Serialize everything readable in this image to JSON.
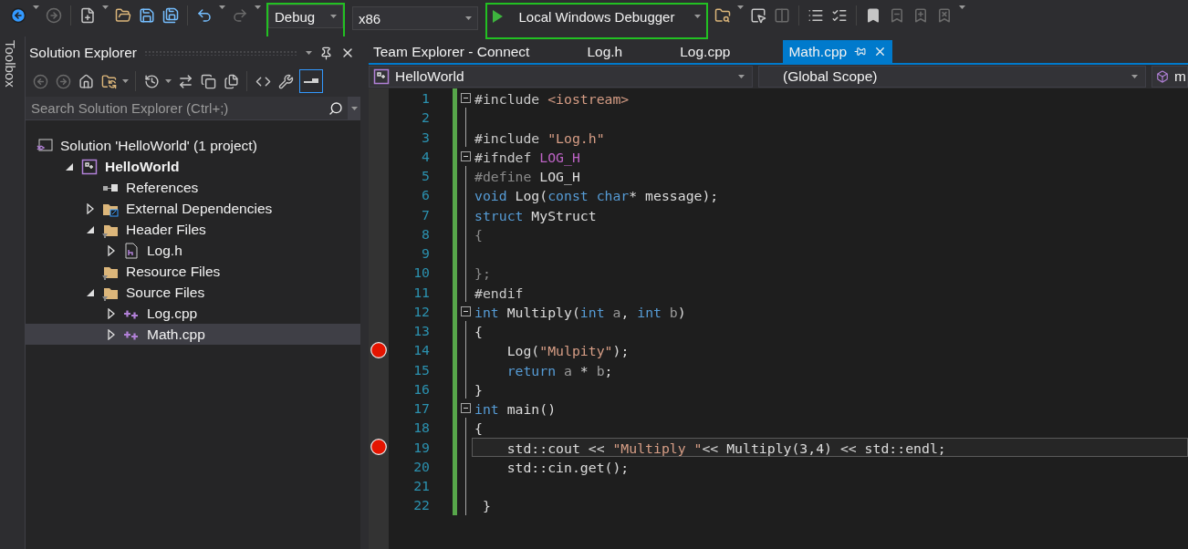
{
  "toolbar": {
    "dropdowns": [
      {
        "kind": "combo",
        "label": "Debug",
        "highlighted": true
      },
      {
        "kind": "combo",
        "label": "x86",
        "highlighted": false
      },
      {
        "kind": "run",
        "label": "Local Windows Debugger",
        "highlighted": true
      }
    ]
  },
  "toolbox": {
    "label": "Toolbox"
  },
  "solution_explorer": {
    "title": "Solution Explorer",
    "preview_on": true,
    "search": {
      "placeholder": "Search Solution Explorer (Ctrl+;)"
    },
    "tree": [
      {
        "kind": "solution",
        "label": "Solution 'HelloWorld' (1 project)",
        "selected": false
      },
      {
        "kind": "project",
        "label": "HelloWorld",
        "selected": false,
        "expanded": true,
        "children": [
          {
            "kind": "references",
            "label": "References",
            "selected": false
          },
          {
            "kind": "external",
            "label": "External Dependencies",
            "selected": false,
            "expanded": false
          },
          {
            "kind": "filter",
            "label": "Header Files",
            "selected": false,
            "expanded": true,
            "children": [
              {
                "kind": "header",
                "label": "Log.h",
                "selected": false,
                "expanded": false
              }
            ]
          },
          {
            "kind": "filter",
            "label": "Resource Files",
            "selected": false
          },
          {
            "kind": "filter",
            "label": "Source Files",
            "selected": false,
            "expanded": true,
            "children": [
              {
                "kind": "cpp",
                "label": "Log.cpp",
                "selected": false,
                "expanded": false
              },
              {
                "kind": "cpp",
                "label": "Math.cpp",
                "selected": true,
                "expanded": false
              }
            ]
          }
        ]
      }
    ]
  },
  "editor": {
    "tabs": [
      {
        "label": "Team Explorer - Connect",
        "selected": false
      },
      {
        "label": "Log.h",
        "selected": false
      },
      {
        "label": "Log.cpp",
        "selected": false
      },
      {
        "label": "Math.cpp",
        "selected": true
      }
    ],
    "navigation": [
      {
        "kind": "project",
        "label": "HelloWorld"
      },
      {
        "kind": "scope",
        "label": "(Global Scope)"
      },
      {
        "kind": "member",
        "label": "m"
      }
    ],
    "lines": [
      {
        "number": "1",
        "kind": "fold",
        "tokens": [
          {
            "kind": "directive",
            "text": "#include "
          },
          {
            "kind": "string",
            "text": "<iostream>"
          }
        ]
      },
      {
        "number": "2",
        "kind": "code"
      },
      {
        "number": "3",
        "kind": "code",
        "tokens": [
          {
            "kind": "directive",
            "text": "#include "
          },
          {
            "kind": "string",
            "text": "\"Log.h\""
          }
        ]
      },
      {
        "number": "4",
        "kind": "fold",
        "tokens": [
          {
            "kind": "directive",
            "text": "#ifndef "
          },
          {
            "kind": "macro",
            "text": "LOG_H"
          }
        ]
      },
      {
        "number": "5",
        "kind": "code",
        "tokens": [
          {
            "kind": "dim",
            "text": "#define"
          },
          {
            "kind": "plain",
            "text": " LOG_H"
          }
        ]
      },
      {
        "number": "6",
        "kind": "code",
        "tokens": [
          {
            "kind": "keyword",
            "text": "void"
          },
          {
            "kind": "plain",
            "text": " Log("
          },
          {
            "kind": "keyword",
            "text": "const char"
          },
          {
            "kind": "plain",
            "text": "* message);"
          }
        ]
      },
      {
        "number": "7",
        "kind": "code",
        "tokens": [
          {
            "kind": "keyword",
            "text": "struct"
          },
          {
            "kind": "plain",
            "text": " MyStruct"
          }
        ]
      },
      {
        "number": "8",
        "kind": "code",
        "tokens": [
          {
            "kind": "dim",
            "text": "{"
          }
        ]
      },
      {
        "number": "9",
        "kind": "code"
      },
      {
        "number": "10",
        "kind": "code",
        "tokens": [
          {
            "kind": "dim",
            "text": "};"
          }
        ]
      },
      {
        "number": "11",
        "kind": "code",
        "tokens": [
          {
            "kind": "directive",
            "text": "#endif"
          }
        ]
      },
      {
        "number": "12",
        "kind": "fold",
        "tokens": [
          {
            "kind": "keyword",
            "text": "int"
          },
          {
            "kind": "plain",
            "text": " Multiply("
          },
          {
            "kind": "keyword",
            "text": "int "
          },
          {
            "kind": "param",
            "text": "a"
          },
          {
            "kind": "plain",
            "text": ", "
          },
          {
            "kind": "keyword",
            "text": "int "
          },
          {
            "kind": "param",
            "text": "b"
          },
          {
            "kind": "plain",
            "text": ")"
          }
        ]
      },
      {
        "number": "13",
        "kind": "code",
        "tokens": [
          {
            "kind": "plain",
            "text": "{"
          }
        ]
      },
      {
        "number": "14",
        "kind": "breakpoint",
        "tokens": [
          {
            "kind": "plain",
            "text": "    Log("
          },
          {
            "kind": "string",
            "text": "\"Mulpity\""
          },
          {
            "kind": "plain",
            "text": ");"
          }
        ]
      },
      {
        "number": "15",
        "kind": "code",
        "tokens": [
          {
            "kind": "keyword",
            "text": "    return "
          },
          {
            "kind": "param",
            "text": "a"
          },
          {
            "kind": "plain",
            "text": " * "
          },
          {
            "kind": "param",
            "text": "b"
          },
          {
            "kind": "plain",
            "text": ";"
          }
        ]
      },
      {
        "number": "16",
        "kind": "code",
        "tokens": [
          {
            "kind": "plain",
            "text": "}"
          }
        ]
      },
      {
        "number": "17",
        "kind": "fold",
        "tokens": [
          {
            "kind": "keyword",
            "text": "int"
          },
          {
            "kind": "plain",
            "text": " main()"
          }
        ]
      },
      {
        "number": "18",
        "kind": "code",
        "tokens": [
          {
            "kind": "plain",
            "text": "{"
          }
        ]
      },
      {
        "number": "19",
        "kind": "current",
        "tokens": [
          {
            "kind": "plain",
            "text": "    std::cout << "
          },
          {
            "kind": "string",
            "text": "\"Multiply \""
          },
          {
            "kind": "plain",
            "text": "<< Multiply(3,4) << std::endl;"
          }
        ]
      },
      {
        "number": "20",
        "kind": "code",
        "tokens": [
          {
            "kind": "plain",
            "text": "    std::cin.get();"
          }
        ]
      },
      {
        "number": "21",
        "kind": "code"
      },
      {
        "number": "22",
        "kind": "code",
        "tokens": [
          {
            "kind": "plain",
            "text": " }"
          }
        ]
      }
    ]
  }
}
